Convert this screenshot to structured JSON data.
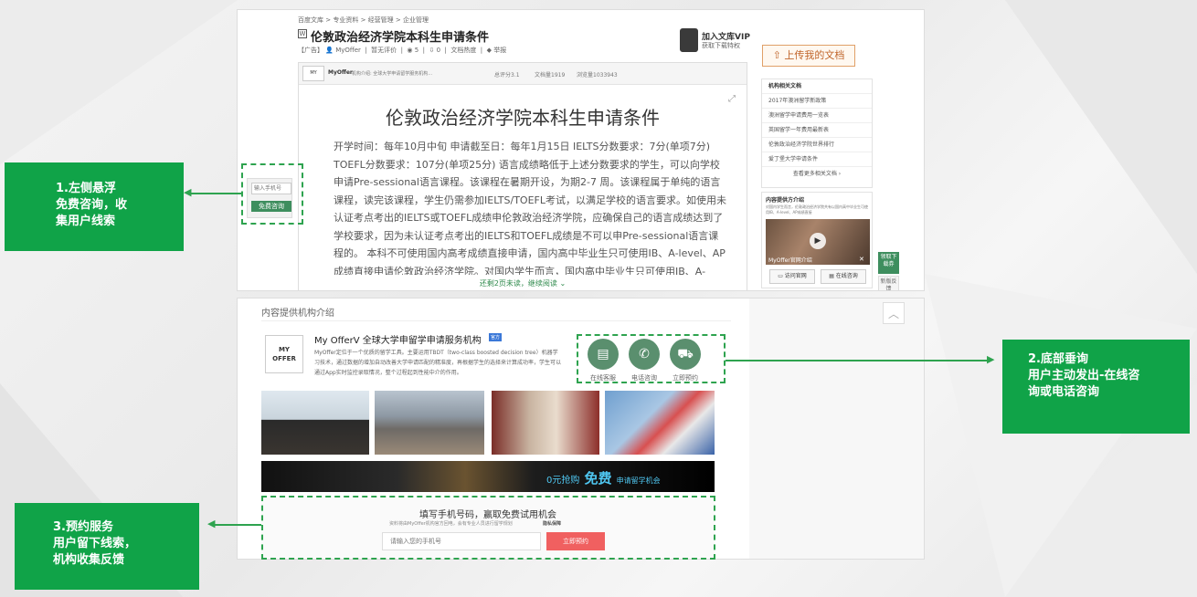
{
  "breadcrumb": [
    "百度文库",
    ">",
    "专业资料",
    ">",
    "经营管理",
    ">",
    "企业管理"
  ],
  "doc": {
    "title": "伦敦政治经济学院本科生申请条件",
    "ad_tag": "【广告】",
    "author": "MyOffer",
    "rating": "暂无评价",
    "views": "5",
    "downloads": "0",
    "doc_score": "文档热度",
    "report": "举报",
    "vip_join": "加入文库VIP",
    "vip_sub": "获取下载特权",
    "upload": "上传我的文档"
  },
  "reader": {
    "org_name": "MyOffer",
    "org_desc": "机构介绍: 全球大学申请留学服务机构...",
    "score": "总评分3.1",
    "doc_count": "文档量1919",
    "visits": "浏览量1033943",
    "title": "伦敦政治经济学院本科生申请条件",
    "body": "开学时间：每年10月中旬 申请截至日：每年1月15日 IELTS分数要求：7分(单项7分) TOEFL分数要求：107分(单项25分) 语言成绩略低于上述分数要求的学生，可以向学校申请Pre-sessional语言课程。该课程在暑期开设，为期2-7 周。该课程属于单纯的语言课程，读完该课程，学生仍需参加IELTS/TOEFL考试，以满足学校的语言要求。如使用未认证考点考出的IELTS或TOEFL成绩申伦敦政治经济学院，应确保自己的语言成绩达到了学校要求，因为未认证考点考出的IELTS和TOEFL成绩是不可以申Pre-sessional语言课程的。 本科不可使用国内高考成绩直接申请，国内高中毕业生只可使用IB、A-level、AP成绩直接申请伦敦政治经济学院。对国内学生而言，国内高中毕业生只可使用IB、A-level、AP成绩直接申请伦敦政治经济学院。对国内学生而言，伦敦政治经济学院共有以政治经济学院共",
    "more": "还剩2页未读，继续阅读"
  },
  "float_form": {
    "placeholder": "输入手机号",
    "button": "免费咨询"
  },
  "related": {
    "header": "机构相关文档",
    "items": [
      "2017年澳洲留学新政策",
      "澳洲留学申请费用一览表",
      "英国留学一年费用最新表",
      "伦敦政治经济学院世界排行",
      "爱丁堡大学申请条件"
    ],
    "more": "查看更多相关文档"
  },
  "video": {
    "header": "内容提供方介绍",
    "desc": "对国内学生而言，伦敦政治经济学院共有以国内高中毕业生可使用IB、A-level、AP成绩直接",
    "caption": "MyOffer官网介绍",
    "btn_site": "访问官网",
    "btn_consult": "在线咨询"
  },
  "side_tabs": {
    "download": "领取下载券",
    "feedback": "新版反馈"
  },
  "org_section": {
    "header": "内容提供机构介绍",
    "logo_text": "MY OFFER",
    "name": "My OfferV 全球大学申留学申请服务机构",
    "badge": "官方",
    "desc": "MyOffer定位于一个优质的留学工具。主要运用TBDT（two-class boosted decision tree）机器学习技术，通过数据的增加自动改善大学申请匹配的精准度，再根据学生的选择来计算成功率，学生可以通过App实时监控录取情况，整个过程起到性能中介的作用。",
    "actions": [
      "在线客服",
      "电话咨询",
      "立即预约"
    ],
    "banner_text": "0元抢购",
    "banner_big": "免费",
    "banner_tail": "申请留学机会",
    "form_title": "填写手机号码，赢取免费试用机会",
    "form_sub": "资料将由MyOffer机构官方回电，会有专业人员进行留学规划",
    "privacy": "隐私保障",
    "phone_placeholder": "请输入您的手机号",
    "submit": "立即预约"
  },
  "notes": [
    {
      "lines": [
        "1.左侧悬浮",
        "免费咨询，收",
        "集用户线索"
      ]
    },
    {
      "lines": [
        "2.底部垂询",
        "用户主动发出-在线咨",
        "询或电话咨询"
      ]
    },
    {
      "lines": [
        "3.预约服务",
        "用户留下线索，",
        "机构收集反馈"
      ]
    }
  ],
  "colors": {
    "accent_green": "#10a348",
    "dashed": "#2ea34f",
    "brand_red": "#f06060",
    "button_green": "#3e8e5e"
  }
}
